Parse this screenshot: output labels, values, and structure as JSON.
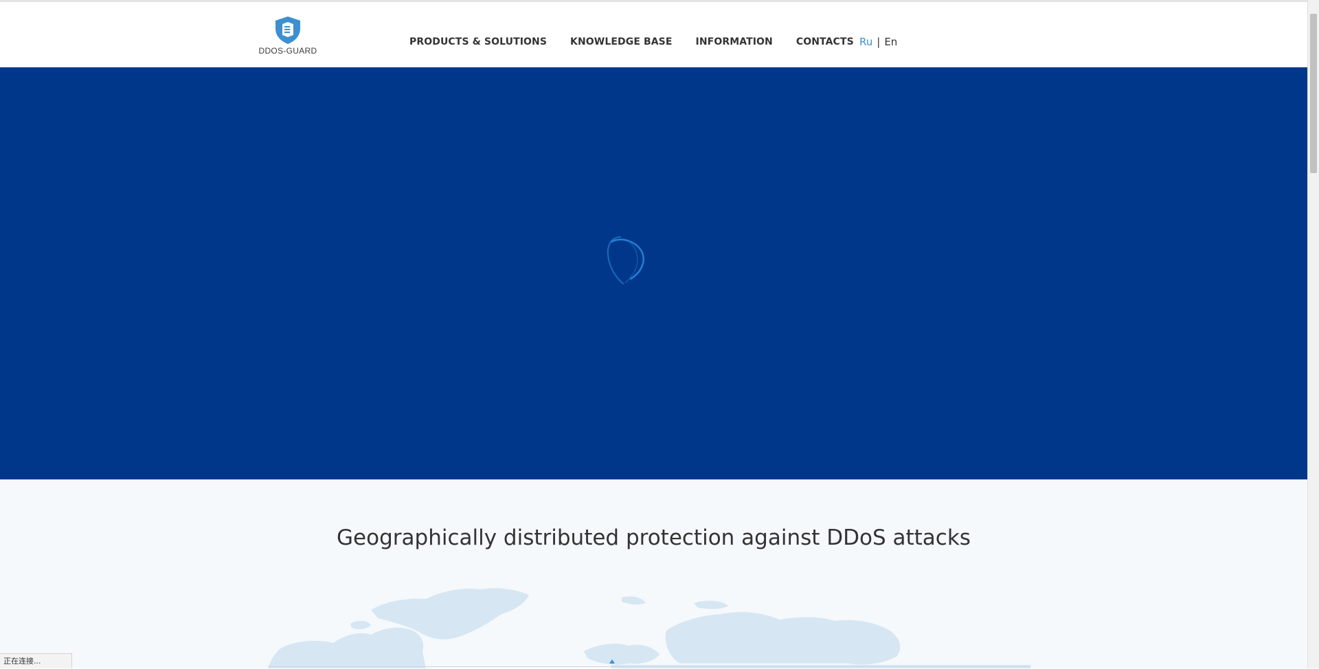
{
  "header": {
    "logo_text": "DDOS-GUARD",
    "nav": [
      {
        "label": "PRODUCTS & SOLUTIONS"
      },
      {
        "label": "KNOWLEDGE BASE"
      },
      {
        "label": "INFORMATION"
      },
      {
        "label": "CONTACTS"
      }
    ],
    "lang": {
      "ru": "Ru",
      "separator": "|",
      "en": "En",
      "active": "Ru"
    }
  },
  "hero": {
    "background_color": "#01378b",
    "loading_icon": "globe-spinner-icon"
  },
  "geo_section": {
    "title": "Geographically distributed protection against DDoS attacks",
    "map_icon": "world-map-icon"
  },
  "status_bar": {
    "text": "正在连接..."
  },
  "colors": {
    "accent": "#3d8fcf",
    "hero": "#01378b",
    "text": "#333333"
  }
}
